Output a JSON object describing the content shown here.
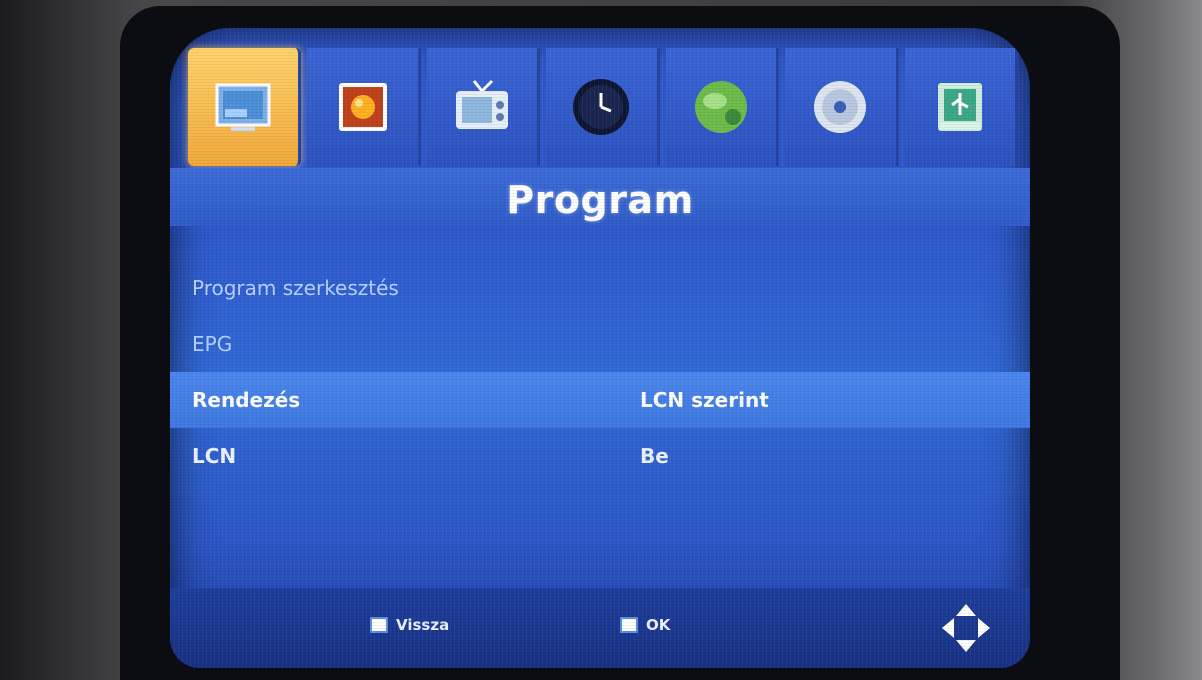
{
  "tabs": [
    {
      "icon": "picture-settings-icon",
      "active": true
    },
    {
      "icon": "image-icon",
      "active": false
    },
    {
      "icon": "tv-channel-icon",
      "active": false
    },
    {
      "icon": "clock-icon",
      "active": false
    },
    {
      "icon": "globe-icon",
      "active": false
    },
    {
      "icon": "disc-icon",
      "active": false
    },
    {
      "icon": "usb-icon",
      "active": false
    }
  ],
  "title": "Program",
  "menu": {
    "items": [
      {
        "label": "Program szerkesztés",
        "value": ""
      },
      {
        "label": "EPG",
        "value": ""
      },
      {
        "label": "Rendezés",
        "value": "LCN szerint"
      },
      {
        "label": "LCN",
        "value": "Be"
      }
    ]
  },
  "footer": {
    "back_label": "Vissza",
    "ok_label": "OK"
  },
  "colors": {
    "screen_blue": "#2d57cc",
    "highlight_blue": "#4a86ec",
    "active_tab": "#f2a93a"
  }
}
